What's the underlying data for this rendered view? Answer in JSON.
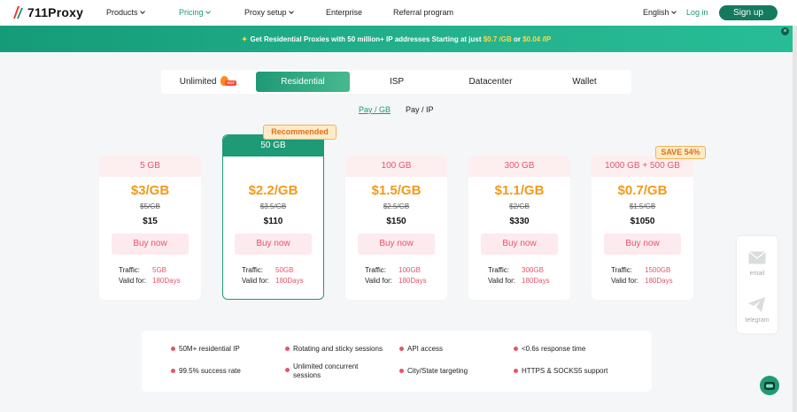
{
  "header": {
    "logo": "711Proxy",
    "nav": [
      {
        "label": "Products",
        "dropdown": true
      },
      {
        "label": "Pricing",
        "dropdown": true,
        "active": true
      },
      {
        "label": "Proxy setup",
        "dropdown": true
      },
      {
        "label": "Enterprise",
        "dropdown": false
      },
      {
        "label": "Referral program",
        "dropdown": false
      }
    ],
    "language": "English",
    "login": "Log in",
    "signup": "Sign up"
  },
  "banner": {
    "prefix": "Get Residential Proxies with 50 million+ IP addresses Starting at just",
    "price_gb": "$0.7 /GB",
    "or": "or",
    "price_ip": "$0.04 /IP",
    "close": "×"
  },
  "tabs": [
    {
      "label": "Unlimited",
      "hot": true
    },
    {
      "label": "Residential",
      "active": true
    },
    {
      "label": "ISP"
    },
    {
      "label": "Datacenter"
    },
    {
      "label": "Wallet"
    }
  ],
  "hot_text": "HOT",
  "pay_toggle": {
    "gb": "Pay / GB",
    "ip": "Pay / IP",
    "active": "gb"
  },
  "recommended_label": "Recommended",
  "save_label": "SAVE 54%",
  "plans": [
    {
      "size": "5 GB",
      "price": "$3/GB",
      "original": "$5/GB",
      "total": "$15",
      "buy": "Buy now",
      "traffic_label": "Traffic:",
      "traffic": "5GB",
      "valid_label": "Valid for:",
      "valid": "180Days"
    },
    {
      "size": "50 GB",
      "price": "$2.2/GB",
      "original": "$3.5/GB",
      "total": "$110",
      "buy": "Buy now",
      "traffic_label": "Traffic:",
      "traffic": "50GB",
      "valid_label": "Valid for:",
      "valid": "180Days",
      "featured": true
    },
    {
      "size": "100 GB",
      "price": "$1.5/GB",
      "original": "$2.5/GB",
      "total": "$150",
      "buy": "Buy now",
      "traffic_label": "Traffic:",
      "traffic": "100GB",
      "valid_label": "Valid for:",
      "valid": "180Days"
    },
    {
      "size": "300 GB",
      "price": "$1.1/GB",
      "original": "$2/GB",
      "total": "$330",
      "buy": "Buy now",
      "traffic_label": "Traffic:",
      "traffic": "300GB",
      "valid_label": "Valid for:",
      "valid": "180Days"
    },
    {
      "size": "1000 GB + 500 GB",
      "price": "$0.7/GB",
      "original": "$1.5/GB",
      "total": "$1050",
      "buy": "Buy now",
      "traffic_label": "Traffic:",
      "traffic": "1500GB",
      "valid_label": "Valid for:",
      "valid": "180Days"
    }
  ],
  "features": [
    "50M+ residential IP",
    "Rotating and sticky sessions",
    "API access",
    "<0.6s response time",
    "99.5% success rate",
    "Unlimited concurrent sessions",
    "City/State targeting",
    "HTTPS & SOCKS5 support"
  ],
  "side": {
    "email": "email",
    "telegram": "telegram"
  },
  "colors": {
    "brand": "#1f9a76",
    "accent": "#f29a1a",
    "pink": "#e5556a"
  }
}
